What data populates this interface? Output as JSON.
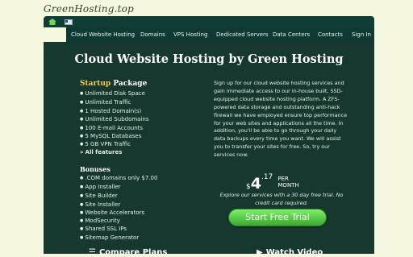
{
  "header": {
    "logo": "GreenHosting.top"
  },
  "topbar": {
    "home_icon": "home-icon",
    "flag_icon": "flag-icon"
  },
  "nav": {
    "items": [
      {
        "label": "Cloud Website Hosting"
      },
      {
        "label": "Domains"
      },
      {
        "label": "VPS Hosting"
      },
      {
        "label": "Dedicated Servers"
      },
      {
        "label": "Data Centers"
      },
      {
        "label": "Contacts"
      },
      {
        "label": "Sign In"
      }
    ]
  },
  "hero": {
    "title": "Cloud Website Hosting by Green Hosting"
  },
  "package": {
    "title_accent": "Startup",
    "title_rest": "Package",
    "features": [
      "Unlimited Disk Space",
      "Unlimited Traffic",
      "1 Hosted Domain(s)",
      "Unlimited Subdomains",
      "100 E-mail Accounts",
      "5 MySQL Databases",
      "5 GB VPN Traffic"
    ],
    "all_features": "All features",
    "bonuses_title": "Bonuses",
    "bonuses": [
      ".COM domains only $7.00",
      "App Installer",
      "Site Builder",
      "Site Installer",
      "Website Accelerators",
      "ModSecurity",
      "Shared SSL IPs",
      "Sitemap Generator"
    ]
  },
  "description": "Sign up for our cloud website hosting services and gain immediate access to our in-house built, SSD-equipped cloud website hosting platform. A ZFS-powered data storage and outstanding anti-hack firewall we have employed ensure top performance for your web sites and applications all the time. In addition, you'll be able to go through your daily data backups every time you want. We will assist you to transfer your sites for free. So, try our services now.",
  "pricing": {
    "currency": "$",
    "amount": "4",
    "cents": ".17",
    "per": "PER",
    "period": "MONTH",
    "explore_text": "Explore our services with a 30 day free trial. No credit card required.",
    "cta_label": "Start Free Trial"
  },
  "bottom_links": {
    "compare": "Compare Plans",
    "video": "Watch Video"
  }
}
